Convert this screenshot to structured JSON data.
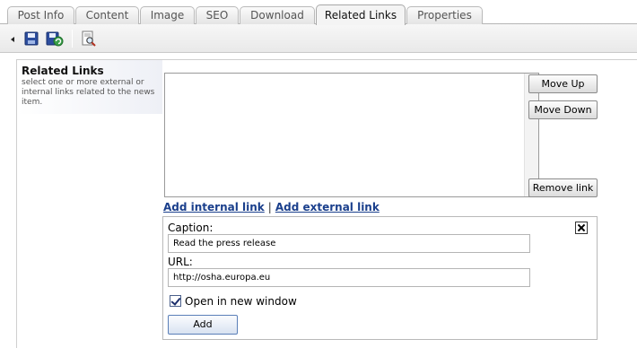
{
  "tabs": [
    {
      "label": "Post Info"
    },
    {
      "label": "Content"
    },
    {
      "label": "Image"
    },
    {
      "label": "SEO"
    },
    {
      "label": "Download"
    },
    {
      "label": "Related Links",
      "active": true
    },
    {
      "label": "Properties"
    }
  ],
  "toolbar": {
    "icons": [
      "collapse-arrow-icon",
      "save-icon",
      "save-and-refresh-icon",
      "preview-icon"
    ]
  },
  "related_links": {
    "title": "Related Links",
    "description": "select one or more external or internal links related to the news item.",
    "move_up_label": "Move Up",
    "move_down_label": "Move Down",
    "remove_link_label": "Remove link",
    "add_internal_label": "Add internal link",
    "separator": "|",
    "add_external_label": "Add external link"
  },
  "editor": {
    "caption_label": "Caption:",
    "caption_value": "Read the press release",
    "url_label": "URL:",
    "url_value": "http://osha.europa.eu",
    "open_new_window_label": "Open in new window",
    "open_new_window_checked": true,
    "add_label": "Add"
  },
  "colors": {
    "link": "#1a3f8c",
    "add_button_border": "#5a7fb8"
  }
}
